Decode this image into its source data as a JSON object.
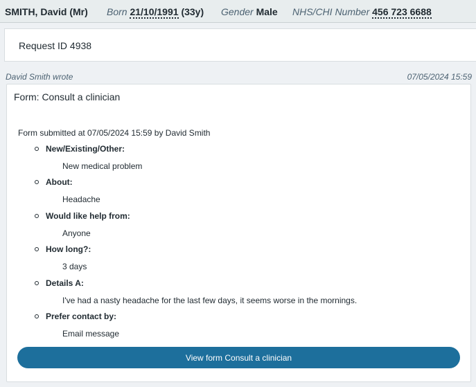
{
  "patient": {
    "name": "SMITH, David (Mr)",
    "born_label": "Born",
    "dob": "21/10/1991",
    "age": "(33y)",
    "gender_label": "Gender",
    "gender": "Male",
    "nhs_label": "NHS/CHI Number",
    "nhs_number": "456 723 6688"
  },
  "request": {
    "id_text": "Request ID 4938"
  },
  "message": {
    "author_line": "David Smith wrote",
    "timestamp": "07/05/2024 15:59",
    "form_title": "Form: Consult a clinician",
    "submitted_line": "Form submitted at 07/05/2024 15:59 by David Smith",
    "fields": [
      {
        "question": "New/Existing/Other:",
        "answer": "New medical problem"
      },
      {
        "question": "About:",
        "answer": "Headache"
      },
      {
        "question": "Would like help from:",
        "answer": "Anyone"
      },
      {
        "question": "How long?:",
        "answer": "3 days"
      },
      {
        "question": "Details A:",
        "answer": "I've had a nasty headache for the last few days, it seems worse in the mornings."
      },
      {
        "question": "Prefer contact by:",
        "answer": "Email message"
      }
    ],
    "view_button_label": "View form Consult a clinician"
  },
  "colors": {
    "button": "#1d6f9c",
    "banner": "#e8edee",
    "page_bg": "#eef1f4"
  }
}
